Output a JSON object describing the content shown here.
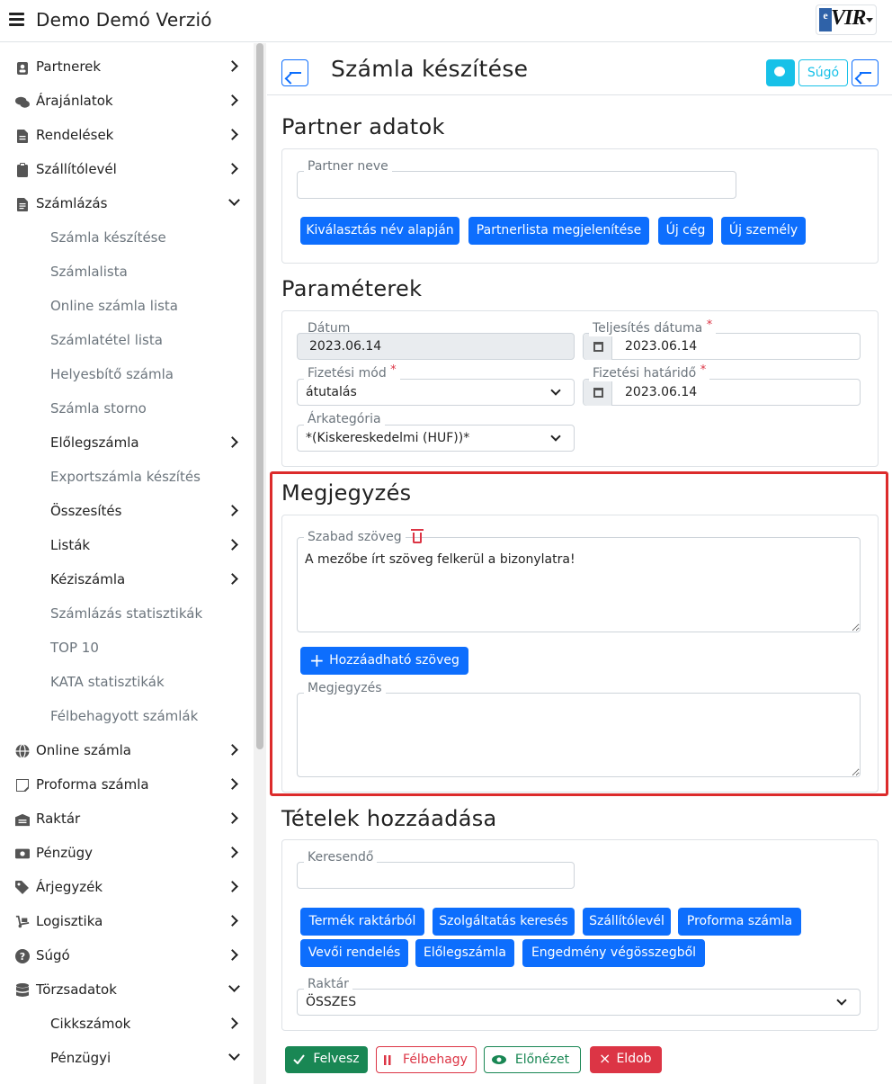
{
  "app": {
    "title": "Demo Demó Verzió",
    "logo_letter": "e",
    "logo_text": "VIR"
  },
  "sidebar": {
    "items": [
      {
        "label": "Partnerek",
        "icon": "person-badge-icon"
      },
      {
        "label": "Árajánlatok",
        "icon": "chat-bubbles-icon"
      },
      {
        "label": "Rendelések",
        "icon": "document-icon"
      },
      {
        "label": "Szállítólevél",
        "icon": "clipboard-icon"
      },
      {
        "label": "Számlázás",
        "icon": "invoice-icon"
      },
      {
        "label": "Számla készítése"
      },
      {
        "label": "Számlalista"
      },
      {
        "label": "Online számla lista"
      },
      {
        "label": "Számlatétel lista"
      },
      {
        "label": "Helyesbítő számla"
      },
      {
        "label": "Számla storno"
      },
      {
        "label": "Előlegszámla"
      },
      {
        "label": "Exportszámla készítés"
      },
      {
        "label": "Összesítés"
      },
      {
        "label": "Listák"
      },
      {
        "label": "Kéziszámla"
      },
      {
        "label": "Számlázás statisztikák"
      },
      {
        "label": "TOP 10"
      },
      {
        "label": "KATA statisztikák"
      },
      {
        "label": "Félbehagyott számlák"
      },
      {
        "label": "Online számla",
        "icon": "globe-icon"
      },
      {
        "label": "Proforma számla",
        "icon": "note-icon"
      },
      {
        "label": "Raktár",
        "icon": "warehouse-icon"
      },
      {
        "label": "Pénzügy",
        "icon": "money-icon"
      },
      {
        "label": "Árjegyzék",
        "icon": "tags-icon"
      },
      {
        "label": "Logisztika",
        "icon": "dolly-icon"
      },
      {
        "label": "Súgó",
        "icon": "question-circle-icon"
      },
      {
        "label": "Törzsadatok",
        "icon": "database-icon"
      },
      {
        "label": "Cikkszámok"
      },
      {
        "label": "Pénzügyi"
      }
    ]
  },
  "page": {
    "title": "Számla készítése",
    "help_label": "Súgó"
  },
  "partner": {
    "section_title": "Partner adatok",
    "name_label": "Partner neve",
    "name_value": "",
    "buttons": [
      "Kiválasztás név alapján",
      "Partnerlista megjelenítése",
      "Új cég",
      "Új személy"
    ]
  },
  "params": {
    "section_title": "Paraméterek",
    "datum_label": "Dátum",
    "datum_value": "2023.06.14",
    "teljesites_label": "Teljesítés dátuma",
    "teljesites_value": "2023.06.14",
    "fizetesi_mod_label": "Fizetési mód",
    "fizetesi_mod_value": "átutalás",
    "hatarido_label": "Fizetési határidő",
    "hatarido_value": "2023.06.14",
    "arkategoria_label": "Árkategória",
    "arkategoria_value": "*(Kiskereskedelmi (HUF))*",
    "required_mark": "*"
  },
  "note": {
    "section_title": "Megjegyzés",
    "free_text_label": "Szabad szöveg",
    "free_text_value": "A mezőbe írt szöveg felkerül a bizonylatra!",
    "add_text_button": "Hozzáadható szöveg",
    "note_label": "Megjegyzés",
    "note_value": ""
  },
  "items": {
    "section_title": "Tételek hozzáadása",
    "search_label": "Keresendő",
    "search_value": "",
    "buttons": [
      "Termék raktárból",
      "Szolgáltatás keresés",
      "Szállítólevél",
      "Proforma számla",
      "Vevői rendelés",
      "Előlegszámla",
      "Engedmény végösszegből"
    ],
    "warehouse_label": "Raktár",
    "warehouse_value": "ÖSSZES"
  },
  "actions": {
    "save": "Felvesz",
    "pause": "Félbehagy",
    "preview": "Előnézet",
    "discard": "Eldob"
  },
  "colors": {
    "primary": "#0d6efd",
    "success": "#198754",
    "danger": "#dc3545",
    "info": "#17c1e8",
    "highlight": "#dc2b2b"
  }
}
